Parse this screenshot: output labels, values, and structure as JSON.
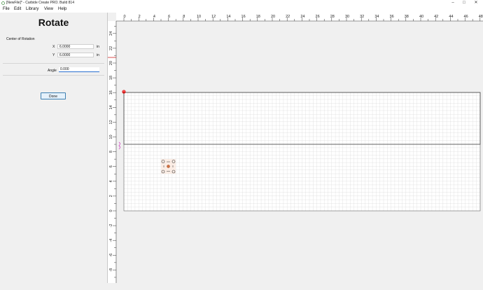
{
  "window": {
    "title": "[NewFile]* - Carbide Create PRO. Build 814",
    "minimize_glyph": "–",
    "maximize_glyph": "□",
    "close_glyph": "✕"
  },
  "menu": [
    "File",
    "Edit",
    "Library",
    "View",
    "Help"
  ],
  "panel": {
    "title": "Rotate",
    "section_label": "Center of Rotation",
    "x_label": "X",
    "x_value": "6.0000",
    "x_unit": "in",
    "y_label": "Y",
    "y_value": "6.0000",
    "y_unit": "in",
    "angle_label": "Angle",
    "angle_value": "0.000",
    "done_label": "Done"
  },
  "ruler": {
    "top_labels": [
      "0",
      "2",
      "4",
      "6",
      "8",
      "10",
      "12",
      "14",
      "16",
      "18",
      "20",
      "22",
      "24",
      "26",
      "28",
      "30",
      "32",
      "34",
      "36",
      "38",
      "40",
      "42",
      "44",
      "46",
      "48"
    ],
    "left_labels": [
      "24",
      "22",
      "20",
      "18",
      "16",
      "14",
      "12",
      "10",
      "8",
      "6",
      "4",
      "2",
      "0",
      "-2",
      "-4",
      "-6",
      "-8"
    ]
  },
  "colors": {
    "accent": "#2a6fd0",
    "origin_marker": "#d02020",
    "canvas_bg": "#ffffff",
    "grid": "#d9d9d9",
    "stock_border": "#555555",
    "rotate_handle": "#c98a6a"
  },
  "icons": {
    "app": "carbide-create-icon",
    "origin": "red-origin-marker-icon",
    "rotate_handle": "rotation-center-handle-icon"
  }
}
